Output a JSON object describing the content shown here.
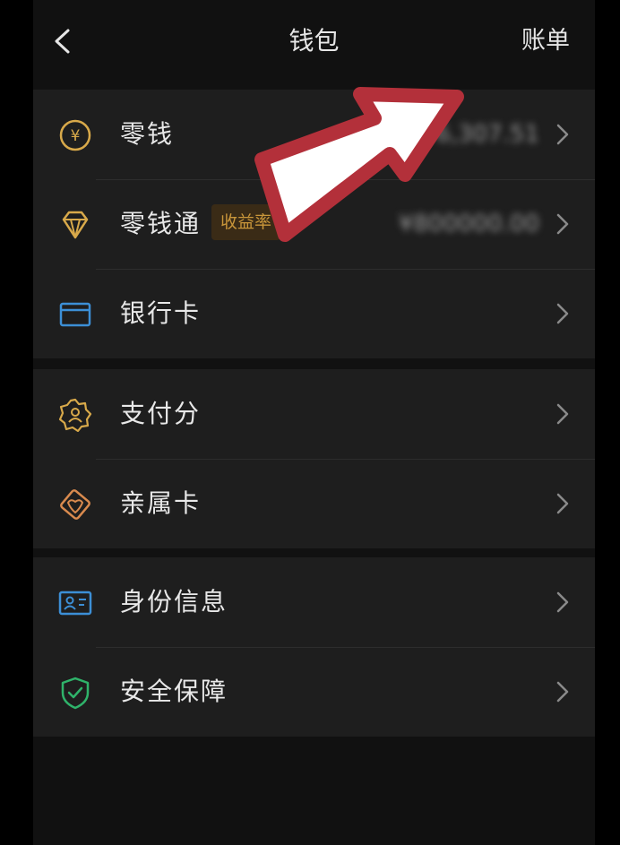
{
  "header": {
    "title": "钱包",
    "right_link": "账单"
  },
  "groups": [
    {
      "items": [
        {
          "label": "零钱",
          "value": "¥6,307.51",
          "icon": "yuan-icon"
        },
        {
          "label": "零钱通",
          "badge": "收益率",
          "value": "¥800000.00",
          "icon": "diamond-icon"
        },
        {
          "label": "银行卡",
          "icon": "bank-card-icon"
        }
      ]
    },
    {
      "items": [
        {
          "label": "支付分",
          "icon": "pay-score-icon"
        },
        {
          "label": "亲属卡",
          "icon": "family-card-icon"
        }
      ]
    },
    {
      "items": [
        {
          "label": "身份信息",
          "icon": "id-card-icon"
        },
        {
          "label": "安全保障",
          "icon": "shield-icon"
        }
      ]
    }
  ],
  "colors": {
    "background": "#111111",
    "row_background": "#1e1e1e",
    "gold_icon": "#d8a94a",
    "blue_icon": "#3c8fd6",
    "orange_icon": "#d98a4e",
    "green_icon": "#2fb36a",
    "annotation_arrow_fill": "#ffffff",
    "annotation_arrow_outline": "#b3303a"
  }
}
